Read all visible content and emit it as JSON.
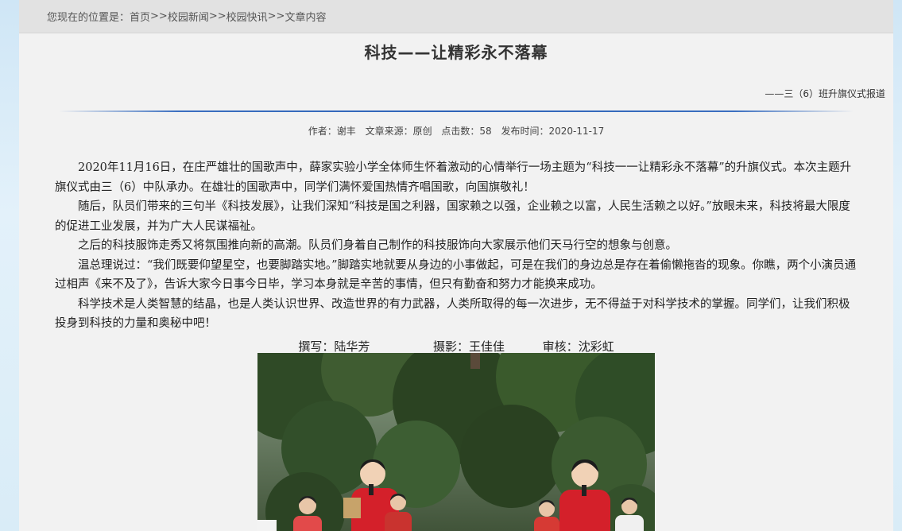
{
  "breadcrumb": {
    "prefix": "您现在的位置是：",
    "items": [
      "首页",
      "校园新闻",
      "校园快讯",
      "文章内容"
    ],
    "separator": ">>"
  },
  "article": {
    "title": "科技——让精彩永不落幕",
    "subtitle": "——三（6）班升旗仪式报道",
    "meta": {
      "author": "作者：谢丰",
      "source": "文章来源：原创",
      "hits": "点击数：58",
      "date": "发布时间：2020-11-17"
    },
    "paragraphs": [
      "2020年11月16日，在庄严雄壮的国歌声中，薛家实验小学全体师生怀着激动的心情举行一场主题为“科技一一让精彩永不落幕”的升旗仪式。本次主题升旗仪式由三（6）中队承办。在雄壮的国歌声中，同学们满怀爱国热情齐唱国歌，向国旗敬礼！",
      "随后，队员们带来的三句半《科技发展》，让我们深知“科技是国之利器，国家赖之以强，企业赖之以富，人民生活赖之以好。”放眼未来，科技将最大限度的促进工业发展，并为广大人民谋福祉。",
      "之后的科技服饰走秀又将氛围推向新的高潮。队员们身着自己制作的科技服饰向大家展示他们天马行空的想象与创意。",
      "温总理说过：“我们既要仰望星空，也要脚踏实地。”脚踏实地就要从身边的小事做起，可是在我们的身边总是存在着偷懒拖沓的现象。你瞧，两个小演员通过相声《来不及了》，告诉大家今日事今日毕，学习本身就是辛苦的事情，但只有勤奋和努力才能换来成功。",
      "科学技术是人类智慧的结晶，也是人类认识世界、改造世界的有力武器，人类所取得的每一次进步，无不得益于对科学技术的掌握。同学们，让我们积极投身到科技的力量和奥秘中吧！"
    ],
    "credits": {
      "writer": "撰写：陆华芳",
      "photo": "摄影：王佳佳",
      "review": "审核：沈彩虹"
    }
  },
  "colors": {
    "rule": "#2e63b8",
    "breadcrumb_bg": "#e2e2e2",
    "page_bg": "#f2f2f2"
  }
}
